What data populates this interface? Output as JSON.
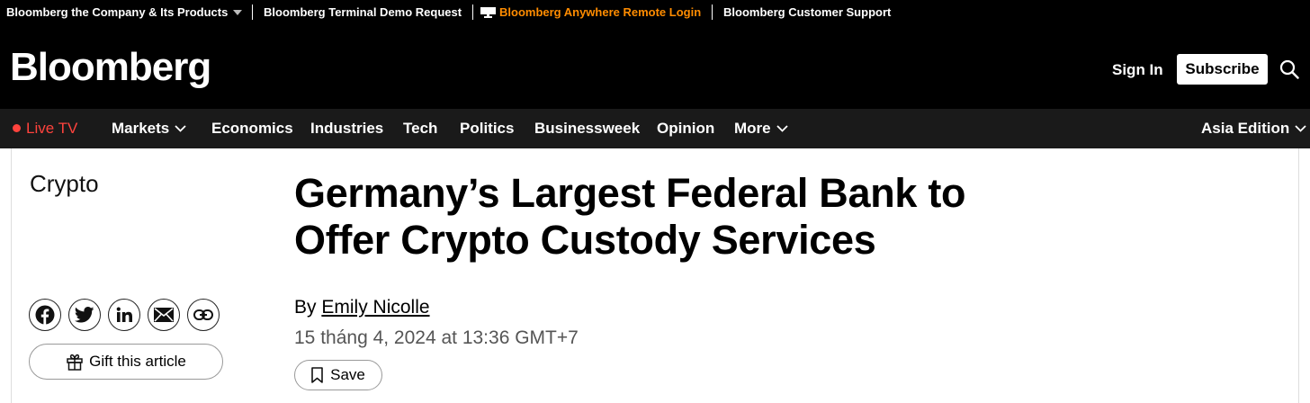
{
  "topbar": {
    "company": "Bloomberg the Company & Its Products",
    "demo": "Bloomberg Terminal Demo Request",
    "anywhere": "Bloomberg Anywhere Remote Login",
    "support": "Bloomberg Customer Support"
  },
  "header": {
    "logo": "Bloomberg",
    "signin": "Sign In",
    "subscribe": "Subscribe"
  },
  "nav": {
    "live": "Live TV",
    "items": [
      "Markets",
      "Economics",
      "Industries",
      "Tech",
      "Politics",
      "Businessweek",
      "Opinion",
      "More"
    ],
    "edition": "Asia Edition"
  },
  "article": {
    "section": "Crypto",
    "headline_line1": "Germany’s Largest Federal Bank to",
    "headline_line2": "Offer Crypto Custody Services",
    "by": "By",
    "author": "Emily Nicolle",
    "date": "15 tháng 4, 2024 at 13:36 GMT+7",
    "save": "Save",
    "gift": "Gift this article"
  },
  "share": {
    "icons": [
      "facebook-icon",
      "twitter-icon",
      "linkedin-icon",
      "email-icon",
      "link-icon"
    ]
  },
  "colors": {
    "accent_orange": "#ff8c00",
    "live_red": "#ff433d",
    "nav_bg": "#1a1a1a",
    "header_bg": "#000000"
  }
}
